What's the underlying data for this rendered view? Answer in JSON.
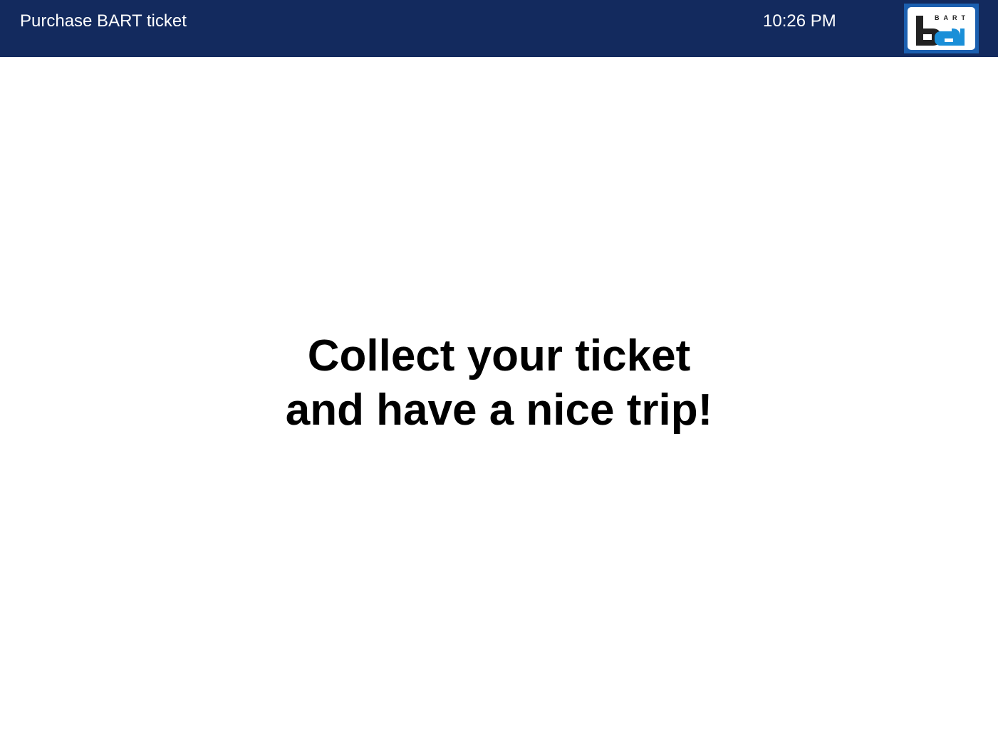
{
  "header": {
    "title": "Purchase BART ticket",
    "time": "10:26 PM",
    "logo": {
      "icon": "bart-logo-icon",
      "letters": "BART",
      "mark": "ba"
    }
  },
  "main": {
    "message_line1": "Collect your ticket",
    "message_line2": "and have a nice trip!"
  },
  "colors": {
    "header_bg": "#132a5e",
    "logo_border": "#1b5fb0",
    "logo_accent": "#1a8fd8",
    "text": "#000000"
  }
}
